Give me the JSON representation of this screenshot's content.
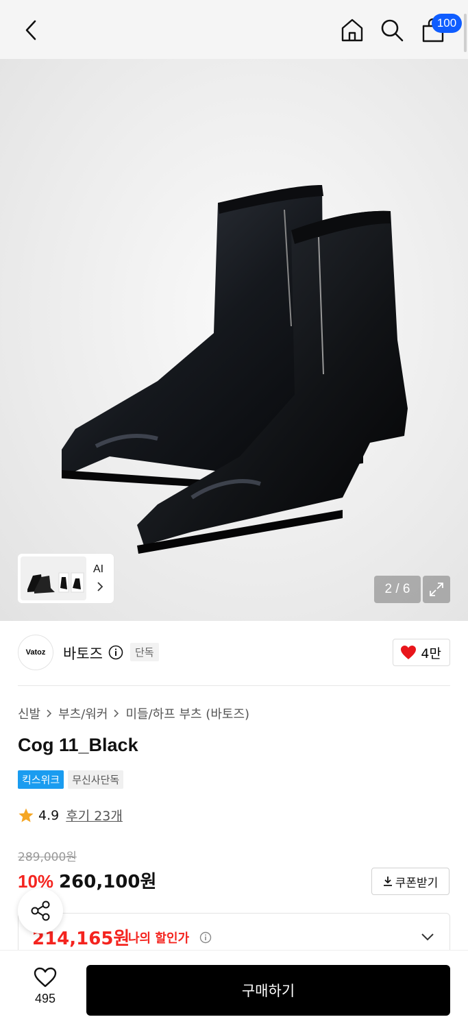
{
  "header": {
    "cart_count": "100"
  },
  "gallery": {
    "ai_label": "AI",
    "pager": "2 / 6"
  },
  "brand": {
    "logo_text": "Vatoz",
    "name": "바토즈",
    "exclusive_tag": "단독",
    "like_count": "4만"
  },
  "breadcrumb": [
    "신발",
    "부츠/워커",
    "미들/하프 부츠 (바토즈)"
  ],
  "product": {
    "title": "Cog 11_Black",
    "tags": [
      "킥스위크",
      "무신사단독"
    ]
  },
  "rating": {
    "score": "4.9",
    "reviews": "후기 23개"
  },
  "price": {
    "original": "289,000원",
    "discount_rate": "10%",
    "sale": "260,100원",
    "coupon_label": "쿠폰받기",
    "my_price": "214,165원",
    "my_price_label": "나의 할인가"
  },
  "bottom": {
    "wish_count": "495",
    "buy_label": "구매하기"
  },
  "colors": {
    "accent_red": "#f4241f",
    "badge_blue": "#0f5dff",
    "tag_blue": "#1a9cf0"
  },
  "icons": [
    "back-icon",
    "home-icon",
    "search-icon",
    "cart-icon",
    "expand-icon",
    "info-icon",
    "heart-icon",
    "star-icon",
    "download-icon",
    "chevron-down-icon",
    "share-icon",
    "heart-outline-icon"
  ]
}
